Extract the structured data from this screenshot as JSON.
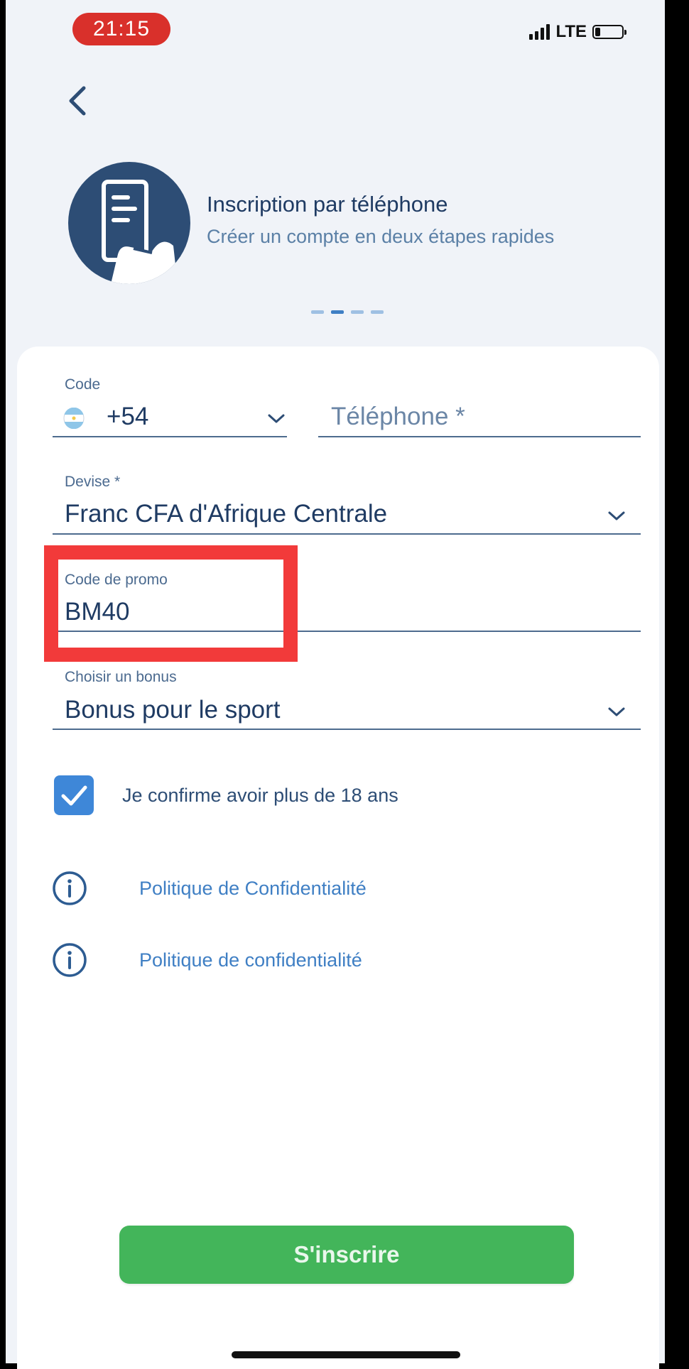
{
  "status_bar": {
    "time": "21:15",
    "network": "LTE",
    "battery_level": 0.2
  },
  "header": {
    "back_icon": "chevron-left-icon",
    "hero_icon": "phone-hand-icon",
    "title": "Inscription par téléphone",
    "subtitle": "Créer un compte en deux étapes rapides",
    "steps_total": 4,
    "step_active": 2
  },
  "form": {
    "code": {
      "label": "Code",
      "flag_icon": "argentina-flag-icon",
      "value": "+54"
    },
    "phone": {
      "placeholder": "Téléphone *"
    },
    "currency": {
      "label": "Devise *",
      "value": "Franc CFA d'Afrique Centrale"
    },
    "promo": {
      "label": "Code de promo",
      "value": "BM40"
    },
    "bonus": {
      "label": "Choisir un bonus",
      "value": "Bonus pour le sport"
    },
    "age_confirm": {
      "label": "Je confirme avoir plus de 18 ans",
      "checked": true
    },
    "links": [
      {
        "label": "Politique de Confidentialité",
        "icon": "info-icon"
      },
      {
        "label": "Politique de confidentialité",
        "icon": "info-icon"
      }
    ],
    "submit_label": "S'inscrire"
  },
  "colors": {
    "accent": "#3e87d8",
    "submit": "#43b55a",
    "highlight": "#f23a3a",
    "time_pill": "#d9302b",
    "text_dark": "#1f3b63"
  }
}
